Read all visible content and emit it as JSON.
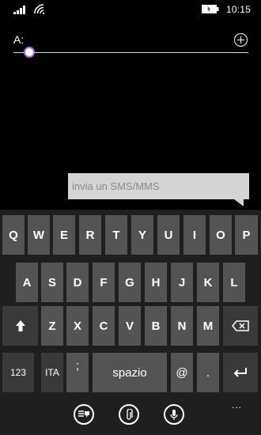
{
  "status_bar": {
    "time": "10:15",
    "signal_icon": "signal-strength-icon",
    "wifi_icon": "wifi-icon",
    "battery_icon": "battery-icon"
  },
  "recipient": {
    "label": "A:",
    "add_icon": "add-contact-icon"
  },
  "message": {
    "placeholder": "invia un SMS/MMS"
  },
  "keyboard": {
    "row1": [
      "Q",
      "W",
      "E",
      "R",
      "T",
      "Y",
      "U",
      "I",
      "O",
      "P"
    ],
    "row2": [
      "A",
      "S",
      "D",
      "F",
      "G",
      "H",
      "J",
      "K",
      "L"
    ],
    "row3": [
      "Z",
      "X",
      "C",
      "V",
      "B",
      "N",
      "M"
    ],
    "shift_icon": "shift-arrow-icon",
    "backspace_icon": "backspace-icon",
    "numbers_label": "123",
    "language_label": "ITA",
    "semicolon_label": ";",
    "comma_label": ",",
    "space_label": "spazio",
    "at_label": "@",
    "period_label": ".",
    "enter_icon": "enter-icon"
  },
  "app_bar": {
    "buttons": [
      "quick-replies-icon",
      "attach-icon",
      "microphone-icon"
    ],
    "more_label": "..."
  }
}
